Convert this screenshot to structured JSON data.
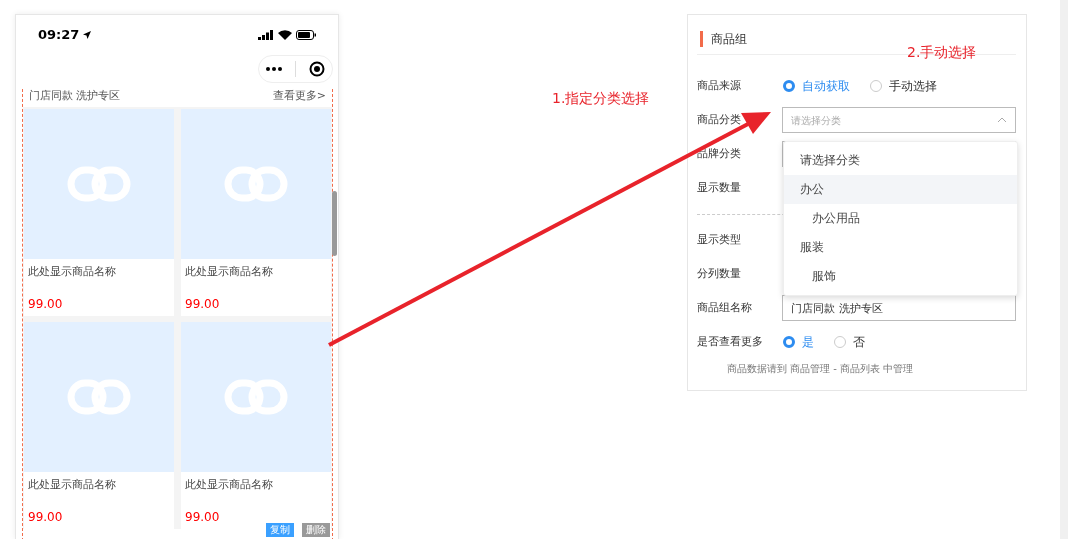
{
  "phone": {
    "time": "09:27",
    "section": {
      "title": "门店同款 洗护专区",
      "more": "查看更多>"
    },
    "products": [
      {
        "name": "此处显示商品名称",
        "price": "99.00"
      },
      {
        "name": "此处显示商品名称",
        "price": "99.00"
      },
      {
        "name": "此处显示商品名称",
        "price": "99.00"
      },
      {
        "name": "此处显示商品名称",
        "price": "99.00"
      }
    ],
    "actions": [
      {
        "label": "复制",
        "kind": "primary"
      },
      {
        "label": "删除",
        "kind": "secondary"
      }
    ]
  },
  "panel": {
    "title": "商品组",
    "fields": [
      {
        "kind": "radio",
        "label": "商品来源",
        "options": [
          {
            "label": "自动获取",
            "selected": true
          },
          {
            "label": "手动选择",
            "selected": false
          }
        ]
      },
      {
        "kind": "select",
        "label": "商品分类",
        "placeholder": "请选择分类",
        "expanded": true,
        "options": [
          {
            "label": "请选择分类",
            "highlighted": false
          },
          {
            "label": "办公",
            "highlighted": true,
            "children": [
              {
                "label": "办公用品",
                "highlighted": false
              }
            ]
          },
          {
            "label": "服装",
            "highlighted": false,
            "children": [
              {
                "label": "服饰",
                "highlighted": false
              }
            ]
          }
        ]
      },
      {
        "kind": "select",
        "label": "品牌分类"
      },
      {
        "kind": "hidden",
        "label": "显示数量"
      },
      {
        "kind": "divider"
      },
      {
        "kind": "hidden",
        "label": "显示类型"
      },
      {
        "kind": "hidden",
        "label": "分列数量"
      },
      {
        "kind": "text",
        "label": "商品组名称",
        "value": "门店同款 洗护专区"
      },
      {
        "kind": "radio",
        "label": "是否查看更多",
        "options": [
          {
            "label": "是",
            "selected": true
          },
          {
            "label": "否",
            "selected": false
          }
        ]
      }
    ],
    "note": "商品数据请到 商品管理 - 商品列表 中管理"
  },
  "annotations": [
    {
      "text": "1.指定分类选择"
    },
    {
      "text": "2.手动选择"
    }
  ]
}
